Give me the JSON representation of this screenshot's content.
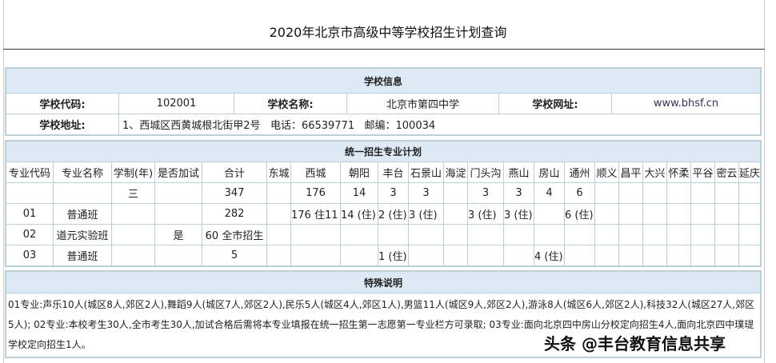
{
  "title": "2020年北京市高级中等学校招生计划查询",
  "school_info": {
    "header": "学校信息",
    "code_label": "学校代码:",
    "code": "102001",
    "name_label": "学校名称:",
    "name": "北京市第四中学",
    "site_label": "学校网址:",
    "site": "www.bhsf.cn",
    "addr_label": "学校地址:",
    "addr": "1、西城区西黄城根北街甲2号   电话：66539771   邮编：100034"
  },
  "plan": {
    "header": "统一招生专业计划",
    "columns": [
      "专业代码",
      "专业名称",
      "学制(年)",
      "是否加试",
      "合计",
      "东城",
      "西城",
      "朝阳",
      "丰台",
      "石景山",
      "海淀",
      "门头沟",
      "燕山",
      "房山",
      "通州",
      "顺义",
      "昌平",
      "大兴",
      "怀柔",
      "平谷",
      "密云",
      "延庆"
    ],
    "rows": [
      [
        "",
        "",
        "三",
        "",
        "347",
        "",
        "176",
        "14",
        "3",
        "3",
        "",
        "3",
        "3",
        "4",
        "6",
        "",
        "",
        "",
        "",
        "",
        "",
        ""
      ],
      [
        "01",
        "普通班",
        "",
        "",
        "282",
        "",
        "176 住11",
        "14 (住)",
        "2 (住)",
        "3 (住)",
        "",
        "3 (住)",
        "3 (住)",
        "",
        "6 (住)",
        "",
        "",
        "",
        "",
        "",
        "",
        ""
      ],
      [
        "02",
        "道元实验班",
        "",
        "是",
        "60 全市招生",
        "",
        "",
        "",
        "",
        "",
        "",
        "",
        "",
        "",
        "",
        "",
        "",
        "",
        "",
        "",
        "",
        ""
      ],
      [
        "03",
        "普通班",
        "",
        "",
        "5",
        "",
        "",
        "",
        "1 (住)",
        "",
        "",
        "",
        "",
        "4 (住)",
        "",
        "",
        "",
        "",
        "",
        "",
        "",
        ""
      ]
    ]
  },
  "notes": {
    "header": "特殊说明",
    "text": "01专业:声乐10人(城区8人,郊区2人),舞蹈9人(城区7人,郊区2人),民乐5人(城区4人,郊区1人),男篮11人(城区9人,郊区2人),游泳8人(城区6人,郊区2人),科技32人(城区27人,郊区5人); 02专业:本校考生30人,全市考生30人,加试合格后需将本专业填报在统一招生第一志愿第一专业栏方可录取; 03专业:面向北京四中房山分校定向招生4人,面向北京四中璞瑅学校定向招生1人。"
  },
  "watermark": "头条 @丰台教育信息共享"
}
